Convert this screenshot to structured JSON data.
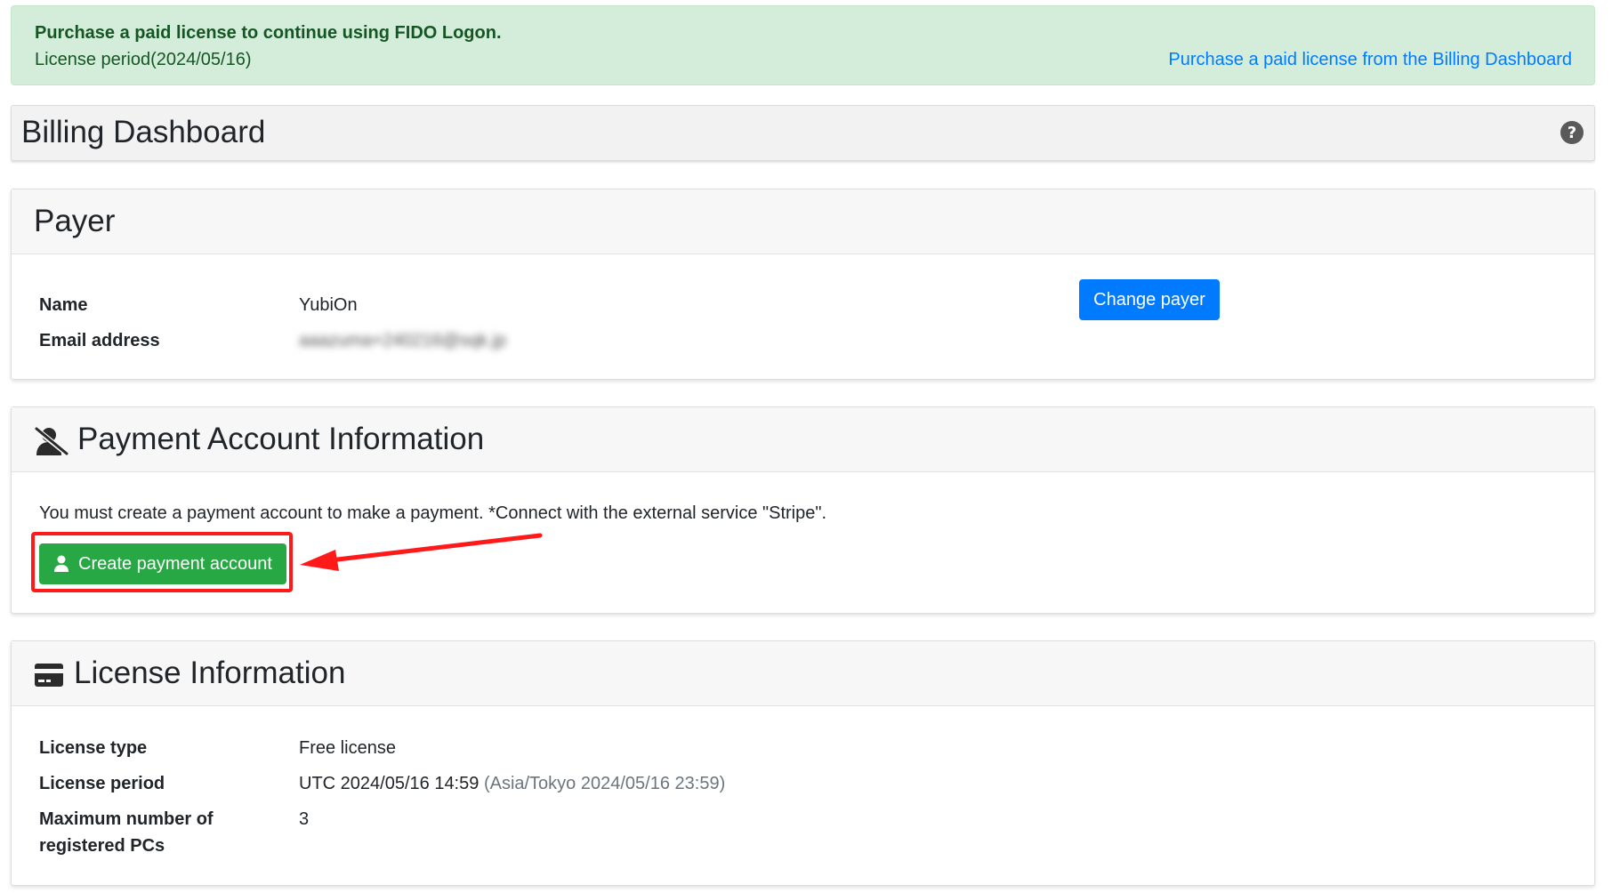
{
  "alert": {
    "title": "Purchase a paid license to continue using FIDO Logon.",
    "period": "License period(2024/05/16)",
    "link": "Purchase a paid license from the Billing Dashboard"
  },
  "page": {
    "title": "Billing Dashboard"
  },
  "payer": {
    "title": "Payer",
    "name_label": "Name",
    "name_value": "YubiOn",
    "email_label": "Email address",
    "email_value": "aaazuma+240216@sqk.jp",
    "change_button": "Change payer"
  },
  "payment": {
    "title": "Payment Account Information",
    "message": "You must create a payment account to make a payment. *Connect with the external service \"Stripe\".",
    "create_button": "Create payment account"
  },
  "license": {
    "title": "License Information",
    "type_label": "License type",
    "type_value": "Free license",
    "period_label": "License period",
    "period_utc": "UTC 2024/05/16 14:59",
    "period_local": "(Asia/Tokyo 2024/05/16 23:59)",
    "max_label_line1": "Maximum number of",
    "max_label_line2": "registered PCs",
    "max_value": "3"
  },
  "colors": {
    "alert_bg": "#d4edda",
    "link": "#007bff",
    "primary_button": "#007bff",
    "success_button": "#28a745",
    "annotation": "#ff1a1a"
  },
  "icons": [
    "help-circle-icon",
    "user-slash-icon",
    "credit-card-icon",
    "user-icon",
    "annotation-arrow"
  ]
}
